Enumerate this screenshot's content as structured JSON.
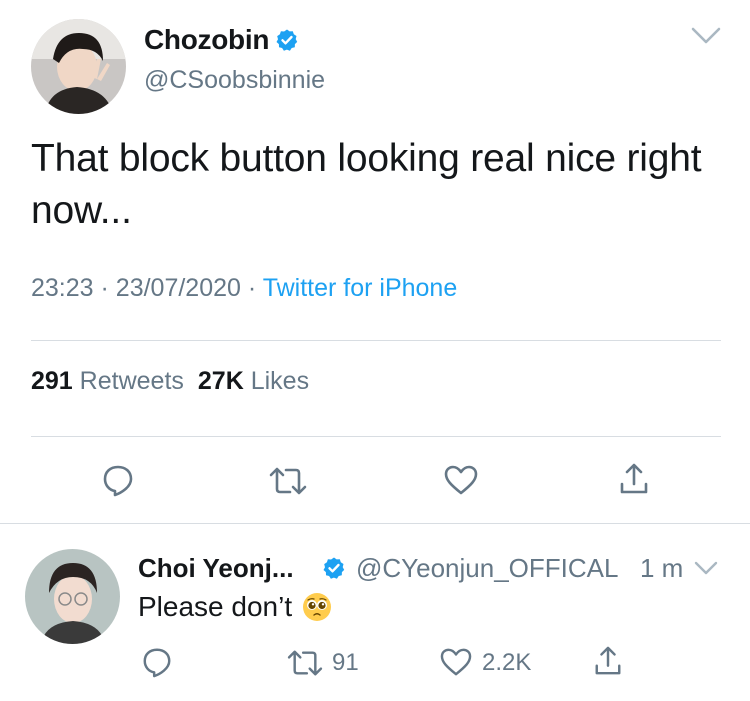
{
  "tweet": {
    "author_name": "Chozobin",
    "author_handle": "@CSoobsbinnie",
    "text": "That block button looking real nice right now...",
    "time": "23:23",
    "separator": "·",
    "date": "23/07/2020",
    "source": "Twitter for iPhone",
    "retweets_count": "291",
    "retweets_label": "Retweets",
    "likes_count": "27K",
    "likes_label": "Likes"
  },
  "reply": {
    "author_name": "Choi Yeonj...",
    "author_handle": "@CYeonjun_OFFICAL",
    "time": "1 m",
    "text": "Please don’t",
    "retweets": "91",
    "likes": "2.2K"
  },
  "colors": {
    "accent": "#1da1f2",
    "secondary_text": "#657786",
    "primary_text": "#14171a",
    "divider": "#d8dde2"
  },
  "icons": {
    "verified": "verified-badge-icon",
    "reply": "reply-icon",
    "retweet": "retweet-icon",
    "like": "heart-icon",
    "share": "share-icon",
    "menu": "chevron-down-icon",
    "emoji": "pleading-face-emoji"
  }
}
